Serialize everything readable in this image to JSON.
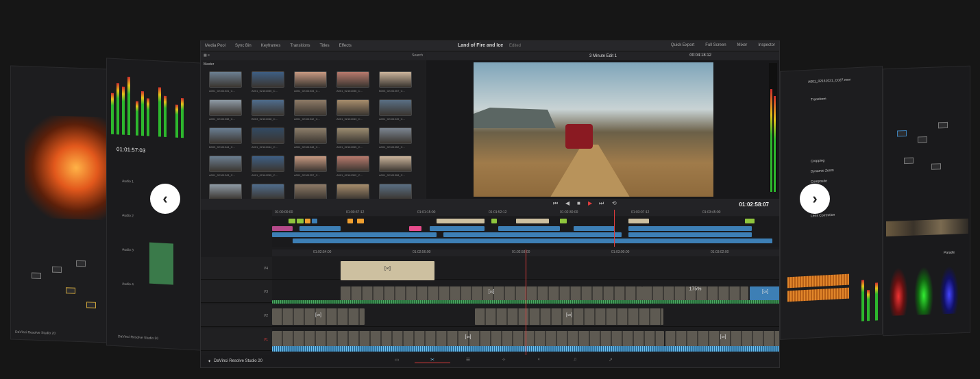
{
  "app": {
    "project_title": "Land of Fire and Ice",
    "project_status": "Edited",
    "timeline_name": "3 Minute Edit 1",
    "viewer_timecode": "00:04:18:12",
    "transport_timecode": "01:02:58:07",
    "brand": "DaVinci Resolve Studio 20"
  },
  "topbar": {
    "left": [
      "Media Pool",
      "Sync Bin",
      "Keyframes",
      "Transitions",
      "Titles",
      "Effects"
    ],
    "right": [
      "Quick Export",
      "Full Screen",
      "Mixer",
      "Inspector"
    ]
  },
  "media_pool": {
    "bin": "Master",
    "search_placeholder": "Search",
    "clips": [
      "A001_02161031_C...",
      "A001_02161035_C...",
      "A001_02161034_C...",
      "A001_02161036_C...",
      "B003_02151057_C...",
      "A001_02161038_C...",
      "B003_02161048_C...",
      "A001_02161042_C...",
      "A001_02161043_C...",
      "A001_02161049_C...",
      "B003_02161044_C...",
      "A001_02161044_C...",
      "A001_02161048_C...",
      "A001_02161055_C...",
      "A001_02161052_C...",
      "A001_02161243_C...",
      "A001_02161255_C...",
      "A001_02161257_C...",
      "A001_02161302_C...",
      "A001_02161308_C...",
      "A001_02161310_C...",
      "A001_02161315_C...",
      "A001_02161320_C...",
      "A001_02161322_C...",
      "A001_02161330_C..."
    ]
  },
  "ruler_top": [
    "01:00:00:00",
    "01:00:37:12",
    "01:01:15:00",
    "01:01:52:12",
    "01:02:30:00",
    "01:03:07:12",
    "01:03:45:00"
  ],
  "ruler_main": [
    "01:02:54:00",
    "01:02:56:00",
    "01:02:58:00",
    "01:03:00:00",
    "01:03:02:00"
  ],
  "tracks": [
    "V4",
    "V3",
    "V2",
    "V1",
    "A1"
  ],
  "clip_speed": "175%",
  "left_panel": {
    "timecode": "01:01:57:03",
    "labels": [
      "Audio 1",
      "Audio 2",
      "Audio 3",
      "Audio 4"
    ],
    "brand": "DaVinci Resolve Studio 20"
  },
  "right_panel": {
    "title": "A001_02161021_C027.mov",
    "labels": [
      "Transform",
      "Cropping",
      "Dynamic Zoom",
      "Composite",
      "Lens Correction"
    ],
    "scope_label": "Parade"
  },
  "nav": {
    "prev_icon": "chevron-left-icon",
    "next_icon": "chevron-right-icon"
  },
  "colors": {
    "accent_blue": "#3d7fb5",
    "accent_red": "#e03c3c",
    "accent_green": "#8fc53d",
    "accent_orange": "#f0a030"
  }
}
